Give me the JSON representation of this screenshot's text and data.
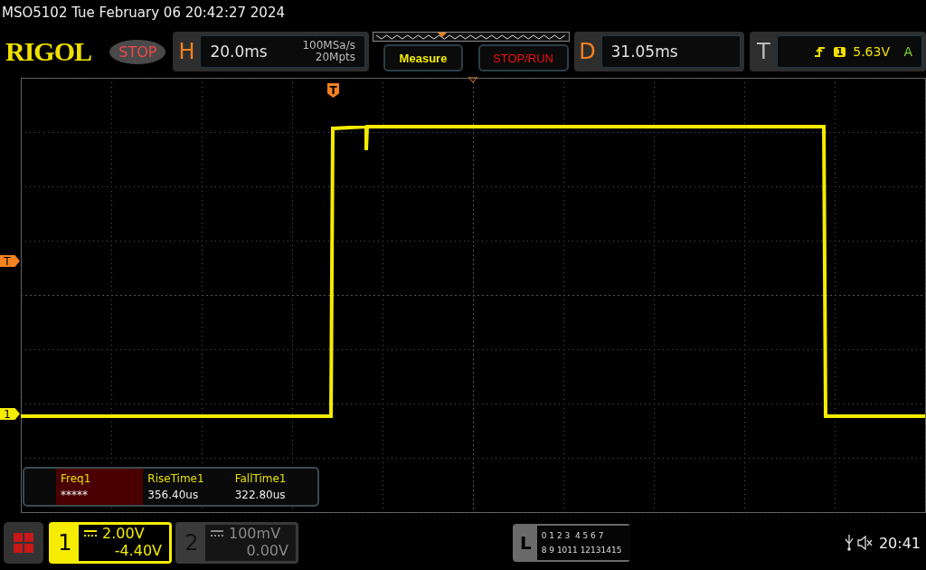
{
  "status_line": "MSO5102  Tue February 06 20:42:27 2024",
  "logo": "RIGOL",
  "run_state": "STOP",
  "horizontal": {
    "label": "H",
    "timebase": "20.0ms",
    "sample_rate": "100MSa/s",
    "memory_depth": "20Mpts"
  },
  "buttons": [
    {
      "label": "Measure",
      "kind": "measure"
    },
    {
      "label": "STOP/RUN",
      "kind": "run"
    }
  ],
  "delay": {
    "label": "D",
    "value": "31.05ms"
  },
  "trigger": {
    "label": "T",
    "source": "1",
    "level": "5.63V",
    "mode": "A"
  },
  "grid_markers": [
    {
      "label": "T",
      "kind": "trigger-position"
    },
    {
      "label": "T",
      "kind": "trigger-level"
    },
    {
      "label": "1",
      "kind": "channel"
    }
  ],
  "measurements": [
    {
      "name": "Freq1",
      "value": "*****",
      "selected": true
    },
    {
      "name": "RiseTime1",
      "value": "356.40us",
      "selected": false
    },
    {
      "name": "FallTime1",
      "value": "322.80us",
      "selected": false
    }
  ],
  "channels": [
    {
      "number": "1",
      "scale": "2.00V",
      "offset": "-4.40V",
      "selected": true
    },
    {
      "number": "2",
      "scale": "100mV",
      "offset": "0.00V",
      "selected": false
    }
  ],
  "logic": {
    "label": "L",
    "row_1": "0 1 2 3  4 5 6 7",
    "row_2": "8 9 1011 12131415"
  },
  "clock": "20:41"
}
